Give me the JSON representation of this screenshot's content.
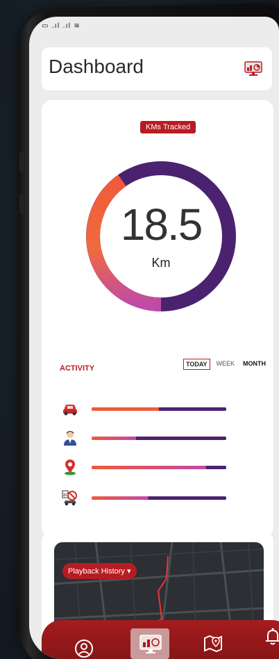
{
  "status_bar": {
    "icons": "▭ .ıl .ıl ≋"
  },
  "header": {
    "title": "Dashboard",
    "icon": "dashboard-monitor-icon"
  },
  "kms": {
    "badge": "KMs Tracked",
    "value": "18.5",
    "unit": "Km",
    "progress": 0.68,
    "colors": {
      "start": "#f2683a",
      "mid": "#c14aa6",
      "end": "#4b2270"
    }
  },
  "activity": {
    "title": "ACTIVITY",
    "tabs": [
      {
        "label": "TODAY",
        "active": true
      },
      {
        "label": "WEEK",
        "active": false
      },
      {
        "label": "MONTH",
        "active": false
      }
    ],
    "rows": [
      {
        "icon": "car-icon",
        "fill": 0.5
      },
      {
        "icon": "driver-icon",
        "fill": 0.33
      },
      {
        "icon": "location-pin-icon",
        "fill": 0.85
      },
      {
        "icon": "no-speeding-icon",
        "fill": 0.42
      }
    ]
  },
  "playback": {
    "label": "Playback History ▾"
  },
  "nav": [
    {
      "icon": "profile-icon",
      "active": false
    },
    {
      "icon": "dashboard-icon",
      "active": true
    },
    {
      "icon": "map-icon",
      "active": false
    },
    {
      "icon": "bell-icon",
      "active": false
    }
  ]
}
